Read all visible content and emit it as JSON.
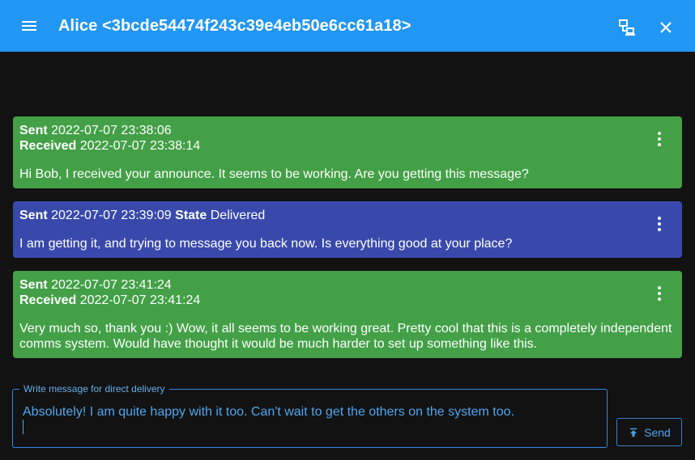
{
  "header": {
    "title": "Alice <3bcde54474f243c39e4eb50e6cc61a18>",
    "menu_icon": "menu-icon",
    "network_icon": "network-icon",
    "close_icon": "close-icon",
    "background_color": "#2196f3"
  },
  "messages": [
    {
      "sent_label": "Sent",
      "sent_time": "2022-07-07 23:38:06",
      "received_label": "Received",
      "received_time": "2022-07-07 23:38:14",
      "text": "Hi Bob, I received your announce. It seems to be working. Are you getting this message?",
      "color": "#43a047"
    },
    {
      "sent_label": "Sent",
      "sent_time": "2022-07-07 23:39:09",
      "state_label": "State",
      "state_value": "Delivered",
      "text": "I am getting it, and trying to message you back now. Is everything good at your place?",
      "color": "#3949ab"
    },
    {
      "sent_label": "Sent",
      "sent_time": "2022-07-07 23:41:24",
      "received_label": "Received",
      "received_time": "2022-07-07 23:41:24",
      "text": "Very much so, thank you :) Wow, it all seems to be working great. Pretty cool that this is a completely independent comms system. Would have thought it would be much harder to set up something like this.",
      "color": "#43a047"
    }
  ],
  "composer": {
    "label": "Write message for direct delivery",
    "value": "Absolutely! I am quite happy with it too. Can't wait to get the others on the system too."
  },
  "send_button": {
    "label": "Send",
    "icon": "send-upload-icon"
  }
}
